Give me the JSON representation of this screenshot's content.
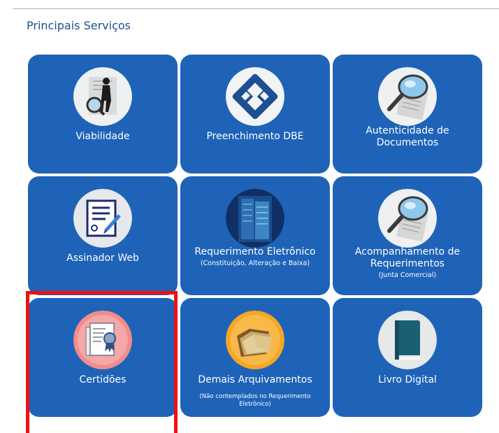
{
  "section": {
    "title": "Principais Serviços"
  },
  "tiles": [
    {
      "label": "Viabilidade",
      "sub": "",
      "icon": "viabilidade-icon"
    },
    {
      "label": "Preenchimento DBE",
      "sub": "",
      "icon": "receita-federal-icon"
    },
    {
      "label": "Autenticidade de Documentos",
      "sub": "",
      "icon": "magnifier-document-icon"
    },
    {
      "label": "Assinador Web",
      "sub": "",
      "icon": "signature-document-icon"
    },
    {
      "label": "Requerimento Eletrônico",
      "sub": "(Constituição, Alteração e Baixa)",
      "icon": "building-icon"
    },
    {
      "label": "Acompanhamento de Requerimentos",
      "sub": "(Junta Comercial)",
      "icon": "magnifier-document-icon"
    },
    {
      "label": "Certidões",
      "sub": "",
      "icon": "certificate-icon"
    },
    {
      "label": "Demais Arquivamentos",
      "sub": "(Não contemplados no Requerimento Eletrônico)",
      "icon": "folder-icon"
    },
    {
      "label": "Livro Digital",
      "sub": "",
      "icon": "book-icon"
    }
  ],
  "colors": {
    "tile": "#1e63b8",
    "title": "#1f4e8f",
    "highlight": "#ef1111"
  }
}
